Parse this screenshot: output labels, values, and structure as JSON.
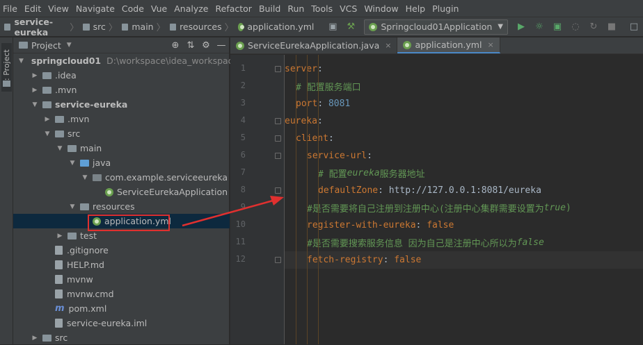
{
  "menu": [
    "File",
    "Edit",
    "View",
    "Navigate",
    "Code",
    "Vue",
    "Analyze",
    "Refactor",
    "Build",
    "Run",
    "Tools",
    "VCS",
    "Window",
    "Help",
    "Plugin"
  ],
  "breadcrumbs": [
    "service-eureka",
    "src",
    "main",
    "resources",
    "application.yml"
  ],
  "run_config": "Springcloud01Application",
  "side_strip_label": "1: Project",
  "project_panel": {
    "title": "Project",
    "tree": [
      {
        "label": "springcloud01",
        "extra": "D:\\workspace\\idea_workspace",
        "depth": 0,
        "arrow": "down",
        "icon": "folder",
        "bold": true
      },
      {
        "label": ".idea",
        "depth": 1,
        "arrow": "right",
        "icon": "folder"
      },
      {
        "label": ".mvn",
        "depth": 1,
        "arrow": "right",
        "icon": "folder"
      },
      {
        "label": "service-eureka",
        "depth": 1,
        "arrow": "down",
        "icon": "folder",
        "bold": true
      },
      {
        "label": ".mvn",
        "depth": 2,
        "arrow": "right",
        "icon": "folder"
      },
      {
        "label": "src",
        "depth": 2,
        "arrow": "down",
        "icon": "folder"
      },
      {
        "label": "main",
        "depth": 3,
        "arrow": "down",
        "icon": "folder"
      },
      {
        "label": "java",
        "depth": 4,
        "arrow": "down",
        "icon": "folder-blue"
      },
      {
        "label": "com.example.serviceeureka",
        "depth": 5,
        "arrow": "down",
        "icon": "package"
      },
      {
        "label": "ServiceEurekaApplication",
        "depth": 6,
        "arrow": "",
        "icon": "leaf"
      },
      {
        "label": "resources",
        "depth": 4,
        "arrow": "down",
        "icon": "folder"
      },
      {
        "label": "application.yml",
        "depth": 5,
        "arrow": "",
        "icon": "leaf",
        "selected": true
      },
      {
        "label": "test",
        "depth": 3,
        "arrow": "right",
        "icon": "folder"
      },
      {
        "label": ".gitignore",
        "depth": 2,
        "arrow": "",
        "icon": "file"
      },
      {
        "label": "HELP.md",
        "depth": 2,
        "arrow": "",
        "icon": "file"
      },
      {
        "label": "mvnw",
        "depth": 2,
        "arrow": "",
        "icon": "file"
      },
      {
        "label": "mvnw.cmd",
        "depth": 2,
        "arrow": "",
        "icon": "file"
      },
      {
        "label": "pom.xml",
        "depth": 2,
        "arrow": "",
        "icon": "maven"
      },
      {
        "label": "service-eureka.iml",
        "depth": 2,
        "arrow": "",
        "icon": "file"
      },
      {
        "label": "src",
        "depth": 1,
        "arrow": "right",
        "icon": "folder"
      }
    ]
  },
  "editor_tabs": [
    {
      "label": "ServiceEurekaApplication.java",
      "active": false
    },
    {
      "label": "application.yml",
      "active": true
    }
  ],
  "code_lines": [
    {
      "n": "1",
      "indent": 0,
      "parts": [
        {
          "cls": "k",
          "text": "server"
        },
        {
          "cls": "t",
          "text": ":"
        }
      ]
    },
    {
      "n": "2",
      "indent": 1,
      "parts": [
        {
          "cls": "c",
          "text": "# 配置服务端口"
        }
      ]
    },
    {
      "n": "3",
      "indent": 1,
      "parts": [
        {
          "cls": "k",
          "text": "port"
        },
        {
          "cls": "t",
          "text": ": "
        },
        {
          "cls": "v",
          "text": "8081"
        }
      ]
    },
    {
      "n": "4",
      "indent": 0,
      "parts": [
        {
          "cls": "k",
          "text": "eureka"
        },
        {
          "cls": "t",
          "text": ":"
        }
      ]
    },
    {
      "n": "5",
      "indent": 1,
      "parts": [
        {
          "cls": "k",
          "text": "client"
        },
        {
          "cls": "t",
          "text": ":"
        }
      ]
    },
    {
      "n": "6",
      "indent": 2,
      "parts": [
        {
          "cls": "k",
          "text": "service-url"
        },
        {
          "cls": "t",
          "text": ":"
        }
      ]
    },
    {
      "n": "7",
      "indent": 3,
      "parts": [
        {
          "cls": "c",
          "text": "# 配置"
        },
        {
          "cls": "ci",
          "text": "eureka"
        },
        {
          "cls": "c",
          "text": "服务器地址"
        }
      ]
    },
    {
      "n": "8",
      "indent": 3,
      "parts": [
        {
          "cls": "k",
          "text": "defaultZone"
        },
        {
          "cls": "t",
          "text": ": http://127.0.0.1:8081/eureka"
        }
      ]
    },
    {
      "n": "9",
      "indent": 2,
      "parts": [
        {
          "cls": "c",
          "text": "#是否需要将自己注册到注册中心(注册中心集群需要设置为"
        },
        {
          "cls": "ci",
          "text": "true"
        },
        {
          "cls": "c",
          "text": ")"
        }
      ]
    },
    {
      "n": "10",
      "indent": 2,
      "parts": [
        {
          "cls": "k",
          "text": "register-with-eureka"
        },
        {
          "cls": "t",
          "text": ": "
        },
        {
          "cls": "k",
          "text": "false"
        }
      ]
    },
    {
      "n": "11",
      "indent": 2,
      "parts": [
        {
          "cls": "c",
          "text": "#是否需要搜索服务信息 因为自己是注册中心所以为"
        },
        {
          "cls": "ci",
          "text": "false"
        }
      ]
    },
    {
      "n": "12",
      "indent": 2,
      "parts": [
        {
          "cls": "k",
          "text": "fetch-registry"
        },
        {
          "cls": "t",
          "text": ": "
        },
        {
          "cls": "k",
          "text": "false"
        }
      ]
    }
  ],
  "icons": {
    "project_header": [
      "target-icon",
      "collapse-icon",
      "gear-icon",
      "hide-icon"
    ],
    "toolbar": [
      "layout-icon",
      "hammer-icon",
      "run-icon",
      "debug-icon",
      "coverage-icon",
      "profile-icon",
      "attach-icon",
      "stop-icon",
      "window-icon"
    ]
  },
  "colors": {
    "selected_row": "#0d293e",
    "highlight_box": "#e0302f",
    "active_tab_underline": "#4a88c7"
  }
}
